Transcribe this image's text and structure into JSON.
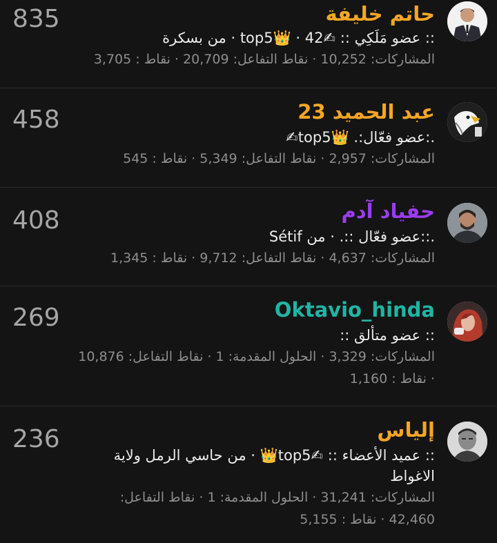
{
  "members": [
    {
      "score": "835",
      "name": "حاتم خليفة",
      "name_color": "#f5a623",
      "rank_line": ":: عضو مَلَكِي :: ✍top5👑 · 42 · من بسكرة",
      "stats_line": "المشاركات: 10,252 · نقاط التفاعل: 20,709 · نقاط : 3,705",
      "avatar": "man-in-suit-photo"
    },
    {
      "score": "458",
      "name": "عبد الحميد 23",
      "name_color": "#f5a623",
      "rank_line": ".:عضو فعّال:. 👑top5✍",
      "stats_line": "المشاركات: 2,957 · نقاط التفاعل: 5,349 · نقاط : 545",
      "avatar": "eagle-logo-photo"
    },
    {
      "score": "408",
      "name": "حفياد آدم",
      "name_color": "#9b3cf0",
      "rank_line": ".::عضو فعّال ::. · من Sétif",
      "stats_line": "المشاركات: 4,637 · نقاط التفاعل: 9,712 · نقاط : 1,345",
      "avatar": "bearded-man-photo"
    },
    {
      "score": "269",
      "name": "Oktavio_hinda",
      "name_color": "#1fb5a4",
      "rank_line": ":: عضو متألق ::",
      "stats_line": "المشاركات: 3,329 · الحلول المقدمة: 1 · نقاط التفاعل: 10,876 · نقاط : 1,160",
      "avatar": "red-hair-person-photo"
    },
    {
      "score": "236",
      "name": "إلياس",
      "name_color": "#f5a623",
      "rank_line": ":: عميد الأعضاء :: ✍top5👑 · من حاسي الرمل ولاية الاغواط",
      "stats_line": "المشاركات: 31,241 · الحلول المقدمة: 1 · نقاط التفاعل: 42,460 · نقاط : 5,155",
      "avatar": "man-portrait-photo"
    }
  ]
}
